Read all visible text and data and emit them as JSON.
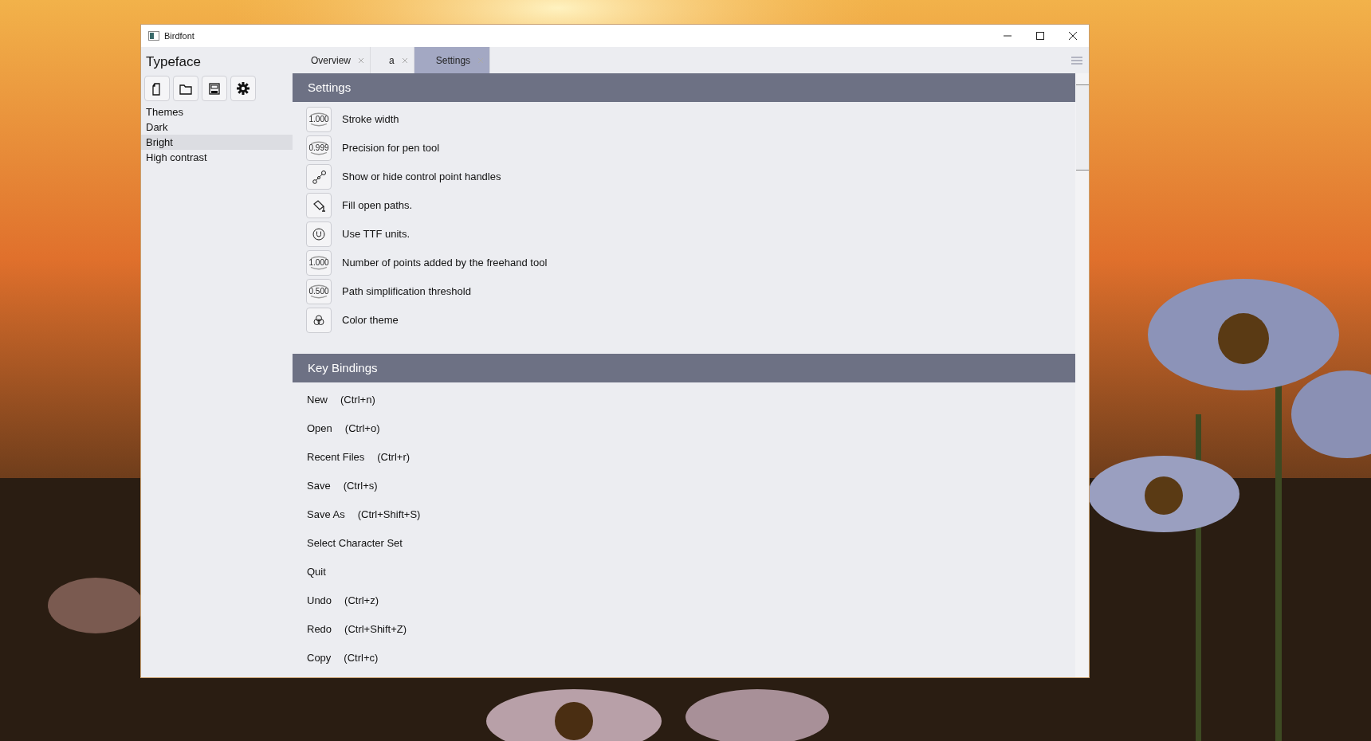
{
  "window": {
    "title": "Birdfont"
  },
  "sidebar": {
    "title": "Typeface",
    "toolbar": [
      {
        "kind": "new"
      },
      {
        "kind": "open"
      },
      {
        "kind": "save"
      },
      {
        "kind": "settings"
      }
    ],
    "themes_heading": "Themes",
    "themes": [
      {
        "label": "Dark",
        "selected": false
      },
      {
        "label": "Bright",
        "selected": true
      },
      {
        "label": "High contrast",
        "selected": false
      }
    ]
  },
  "tabs": [
    {
      "label": "Overview",
      "selected": false
    },
    {
      "label": "a",
      "selected": false
    },
    {
      "label": "Settings",
      "selected": true
    }
  ],
  "settings": {
    "heading": "Settings",
    "items": [
      {
        "kind": "number",
        "value": "1.000",
        "label": "Stroke width"
      },
      {
        "kind": "number",
        "value": "0.999",
        "label": "Precision for pen tool"
      },
      {
        "kind": "handles",
        "label": "Show or hide control point handles"
      },
      {
        "kind": "fill",
        "label": "Fill open paths."
      },
      {
        "kind": "units",
        "label": "Use TTF units."
      },
      {
        "kind": "number",
        "value": "1.000",
        "label": "Number of points added by the freehand tool"
      },
      {
        "kind": "number",
        "value": "0.500",
        "label": "Path simplification threshold"
      },
      {
        "kind": "theme",
        "label": "Color theme"
      }
    ]
  },
  "key_bindings": {
    "heading": "Key Bindings",
    "items": [
      {
        "action": "New",
        "shortcut": "(Ctrl+n)"
      },
      {
        "action": "Open",
        "shortcut": "(Ctrl+o)"
      },
      {
        "action": "Recent Files",
        "shortcut": "(Ctrl+r)"
      },
      {
        "action": "Save",
        "shortcut": "(Ctrl+s)"
      },
      {
        "action": "Save As",
        "shortcut": "(Ctrl+Shift+S)"
      },
      {
        "action": "Select Character Set"
      },
      {
        "action": "Quit"
      },
      {
        "action": "Undo",
        "shortcut": "(Ctrl+z)"
      },
      {
        "action": "Redo",
        "shortcut": "(Ctrl+Shift+Z)"
      },
      {
        "action": "Copy",
        "shortcut": "(Ctrl+c)"
      }
    ]
  }
}
